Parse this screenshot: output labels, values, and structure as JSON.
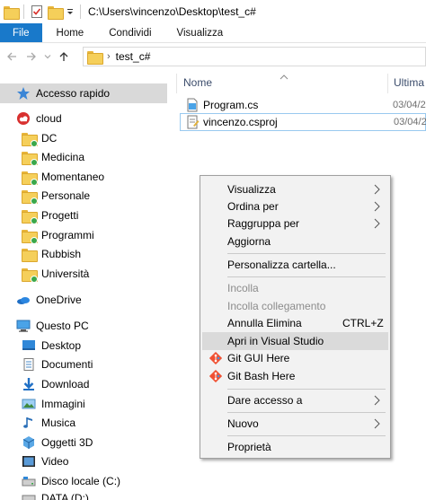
{
  "titlebar": {
    "path": "C:\\Users\\vincenzo\\Desktop\\test_c#"
  },
  "ribbon": {
    "tabs": [
      "File",
      "Home",
      "Condividi",
      "Visualizza"
    ]
  },
  "address": {
    "segment": "test_c#"
  },
  "sidebar": {
    "quick_access": "Accesso rapido",
    "items": [
      {
        "label": "cloud",
        "icon": "cloud-app-icon"
      },
      {
        "label": "DC",
        "icon": "folder-icon"
      },
      {
        "label": "Medicina",
        "icon": "folder-icon"
      },
      {
        "label": "Momentaneo",
        "icon": "folder-icon"
      },
      {
        "label": "Personale",
        "icon": "folder-icon"
      },
      {
        "label": "Progetti",
        "icon": "folder-icon"
      },
      {
        "label": "Programmi",
        "icon": "folder-icon"
      },
      {
        "label": "Rubbish",
        "icon": "folder-icon"
      },
      {
        "label": "Università",
        "icon": "folder-icon"
      }
    ],
    "onedrive": "OneDrive",
    "this_pc": "Questo PC",
    "pc_items": [
      {
        "label": "Desktop",
        "icon": "desktop-icon"
      },
      {
        "label": "Documenti",
        "icon": "documents-icon"
      },
      {
        "label": "Download",
        "icon": "download-icon"
      },
      {
        "label": "Immagini",
        "icon": "pictures-icon"
      },
      {
        "label": "Musica",
        "icon": "music-icon"
      },
      {
        "label": "Oggetti 3D",
        "icon": "objects-3d-icon"
      },
      {
        "label": "Video",
        "icon": "video-icon"
      },
      {
        "label": "Disco locale (C:)",
        "icon": "drive-icon"
      },
      {
        "label": "DATA (D:)",
        "icon": "drive-icon"
      }
    ]
  },
  "columns": {
    "name": "Nome",
    "modified": "Ultima"
  },
  "files": [
    {
      "name": "Program.cs",
      "date": "03/04/2",
      "icon": "cs-file-icon"
    },
    {
      "name": "vincenzo.csproj",
      "date": "03/04/2",
      "icon": "csproj-file-icon"
    }
  ],
  "context_menu": {
    "items": [
      {
        "label": "Visualizza",
        "submenu": true
      },
      {
        "label": "Ordina per",
        "submenu": true
      },
      {
        "label": "Raggruppa per",
        "submenu": true
      },
      {
        "label": "Aggiorna"
      },
      {
        "label": "Personalizza cartella..."
      },
      {
        "label": "Incolla",
        "disabled": true
      },
      {
        "label": "Incolla collegamento",
        "disabled": true
      },
      {
        "label": "Annulla Elimina",
        "shortcut": "CTRL+Z"
      },
      {
        "label": "Apri in Visual Studio",
        "highlighted": true
      },
      {
        "label": "Git GUI Here",
        "icon": "git-icon"
      },
      {
        "label": "Git Bash Here",
        "icon": "git-icon"
      },
      {
        "label": "Dare accesso a",
        "submenu": true
      },
      {
        "label": "Nuovo",
        "submenu": true
      },
      {
        "label": "Proprietà"
      }
    ]
  },
  "colors": {
    "accent": "#1979ca",
    "folder": "#f5cf5a",
    "pin": "#3aa84a"
  }
}
